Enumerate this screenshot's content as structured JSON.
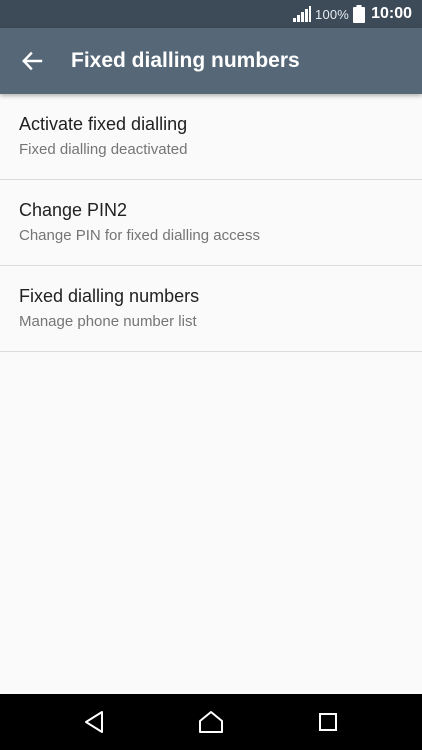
{
  "status_bar": {
    "battery_percent": "100%",
    "time": "10:00",
    "icons": [
      "signal-icon",
      "battery-icon"
    ]
  },
  "app_bar": {
    "title": "Fixed dialling numbers",
    "back_icon": "arrow-back-icon",
    "background_color": "#566878"
  },
  "settings": {
    "items": [
      {
        "title": "Activate fixed dialling",
        "subtitle": "Fixed dialling deactivated"
      },
      {
        "title": "Change PIN2",
        "subtitle": "Change PIN for fixed dialling access"
      },
      {
        "title": "Fixed dialling numbers",
        "subtitle": "Manage phone number list"
      }
    ]
  },
  "nav_bar": {
    "icons": [
      "back-triangle-icon",
      "home-icon",
      "recents-icon"
    ]
  }
}
